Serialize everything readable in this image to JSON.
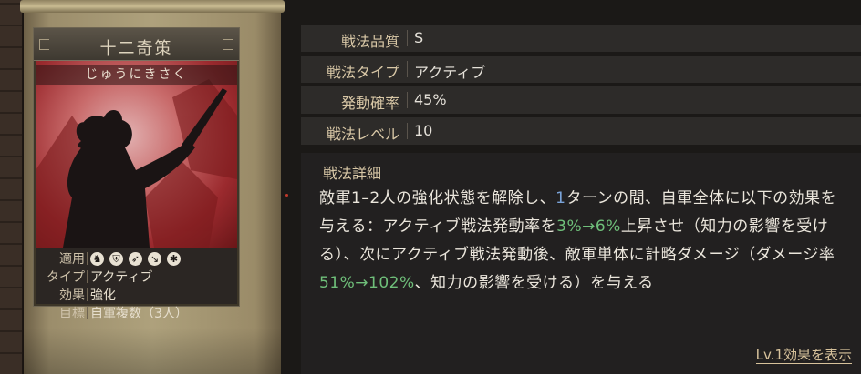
{
  "card": {
    "title": "十二奇策",
    "reading": "じゅうにきさく",
    "props": [
      {
        "key": "適用",
        "icons": [
          "cavalry-icon",
          "shield-icon",
          "bow-icon",
          "spear-icon",
          "siege-icon"
        ]
      },
      {
        "key": "タイプ",
        "value": "アクティブ"
      },
      {
        "key": "効果",
        "value": "強化"
      },
      {
        "key": "目標",
        "value": "自軍複数（3人）"
      }
    ]
  },
  "info": {
    "rows": [
      {
        "label": "戦法品質",
        "value": "S"
      },
      {
        "label": "戦法タイプ",
        "value": "アクティブ"
      },
      {
        "label": "発動確率",
        "value": "45%"
      },
      {
        "label": "戦法レベル",
        "value": "10"
      }
    ],
    "detail_label": "戦法詳細",
    "detail": {
      "p1": "敵軍1–2人の強化状態を解除し、",
      "p2": "1",
      "p3": "ターンの間、自軍全体に以下の効果を与える：アクティブ戦法発動率を",
      "p4": "3%→6%",
      "p5": "上昇させ（知力の影響を受ける）、次にアクティブ戦法発動後、敵軍単体に計略ダメージ（ダメージ率",
      "p6": "51%→102%",
      "p7": "、知力の影響を受ける）を与える"
    },
    "link": "Lv.1効果を表示"
  },
  "colors": {
    "highlight_green": "#6fbf7a",
    "highlight_blue": "#7aa3d8"
  }
}
